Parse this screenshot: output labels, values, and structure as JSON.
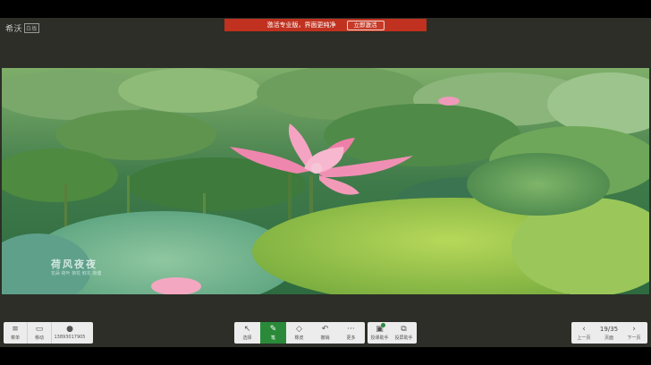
{
  "logo": {
    "text": "希沃",
    "mark": "白板"
  },
  "banner": {
    "message": "激活专业版，界面更纯净",
    "button": "立即激活"
  },
  "watermark": {
    "title": "荷风夜夜",
    "subtitle": "花朵 荷叶 荷花 鲜花 荷塘"
  },
  "left_toolbar": {
    "menu_label": "菜单",
    "tablet_label": "移动",
    "phone": "13893017905"
  },
  "center_toolbar": {
    "items": [
      {
        "label": "选择",
        "icon": "pointer-icon"
      },
      {
        "label": "笔",
        "icon": "pen-icon"
      },
      {
        "label": "橡皮",
        "icon": "eraser-icon"
      },
      {
        "label": "撤销",
        "icon": "undo-icon"
      },
      {
        "label": "更多",
        "icon": "more-icon"
      }
    ],
    "extra": [
      {
        "label": "授课助手",
        "icon": "assistant-icon"
      },
      {
        "label": "投屏助手",
        "icon": "cast-icon"
      }
    ]
  },
  "pager": {
    "current": "19/35",
    "prev_label": "上一页",
    "page_label": "页面",
    "next_label": "下一页"
  },
  "colors": {
    "banner": "#c0311f",
    "active_tool": "#2a8a3a",
    "stage": "#2c2e27"
  }
}
